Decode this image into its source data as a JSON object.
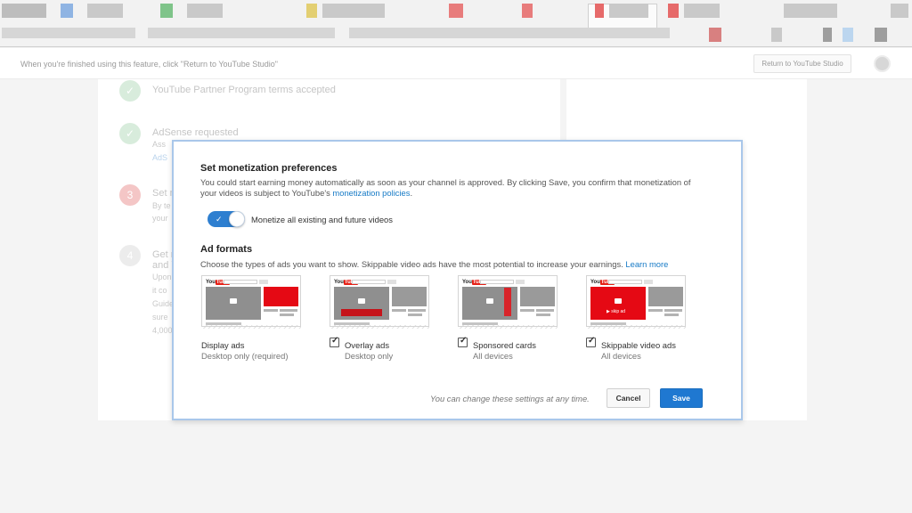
{
  "studio_bar": {
    "notice": "When you're finished using this feature, click \"Return to YouTube Studio\"",
    "return_button": "Return to YouTube Studio"
  },
  "background_steps": [
    {
      "number": "",
      "title": "YouTube Partner Program terms accepted",
      "status": "done",
      "sub": []
    },
    {
      "number": "",
      "title": "AdSense requested",
      "status": "done",
      "sub": [
        "Ass",
        "AdS"
      ]
    },
    {
      "number": "3",
      "title": "Set m",
      "status": "current",
      "sub": [
        "By te",
        "your"
      ]
    },
    {
      "number": "4",
      "title": "Get r",
      "status": "todo",
      "sub": [
        "and Y",
        "Upon",
        "it co",
        "Guide",
        "sure",
        "4,000"
      ]
    }
  ],
  "dialog": {
    "title": "Set monetization preferences",
    "description": "You could start earning money automatically as soon as your channel is approved. By clicking Save, you confirm that monetization of your videos is subject to YouTube's",
    "description_link": "monetization policies",
    "description_end": ".",
    "toggle": {
      "label": "Monetize all existing and future videos",
      "on": true
    },
    "ad_formats_title": "Ad formats",
    "ad_formats_desc": "Choose the types of ads you want to show. Skippable video ads have the most potential to increase your earnings.",
    "learn_more": "Learn more",
    "ad_formats": [
      {
        "name": "Display ads",
        "sub": "Desktop only (required)",
        "checkbox": false,
        "checked": true
      },
      {
        "name": "Overlay ads",
        "sub": "Desktop only",
        "checkbox": true,
        "checked": true
      },
      {
        "name": "Sponsored cards",
        "sub": "All devices",
        "checkbox": true,
        "checked": true
      },
      {
        "name": "Skippable video ads",
        "sub": "All devices",
        "checkbox": true,
        "checked": true
      }
    ],
    "thumb_logo_you": "You",
    "thumb_logo_tube": "Tube",
    "skip_label": "▶ skip ad",
    "footer_note": "You can change these settings at any time.",
    "cancel": "Cancel",
    "save": "Save"
  },
  "colors": {
    "accent": "#1f78d1",
    "link": "#167ac6",
    "ad_red": "#e50914",
    "dialog_border": "#a9c7ea"
  }
}
